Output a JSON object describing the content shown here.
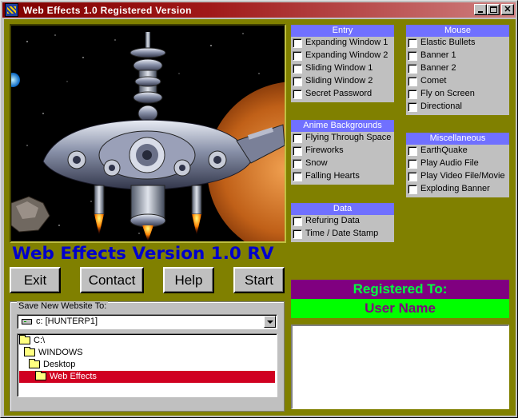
{
  "window": {
    "title": "Web Effects 1.0 Registered Version"
  },
  "app_heading": "Web Effects Version 1.0 RV",
  "buttons": {
    "exit": "Exit",
    "contact": "Contact",
    "help": "Help",
    "start": "Start"
  },
  "save": {
    "legend": "Save New Website To:",
    "drive": "c: [HUNTERP1]",
    "folders": [
      {
        "label": "C:\\",
        "selected": false
      },
      {
        "label": "WINDOWS",
        "selected": false
      },
      {
        "label": "Desktop",
        "selected": false
      },
      {
        "label": "Web Effects",
        "selected": true
      }
    ]
  },
  "panels": {
    "entry": {
      "title": "Entry",
      "items": [
        "Expanding Window 1",
        "Expanding Window 2",
        "Sliding Window 1",
        "Sliding Window 2",
        "Secret Password"
      ]
    },
    "mouse": {
      "title": "Mouse",
      "items": [
        "Elastic Bullets",
        "Banner 1",
        "Banner 2",
        "Comet",
        "Fly on Screen",
        "Directional"
      ]
    },
    "anime": {
      "title": "Anime Backgrounds",
      "items": [
        "Flying Through Space",
        "Fireworks",
        "Snow",
        "Falling Hearts"
      ]
    },
    "misc": {
      "title": "Miscellaneous",
      "items": [
        "EarthQuake",
        "Play Audio File",
        "Play Video File/Movie",
        "Exploding Banner"
      ]
    },
    "data": {
      "title": "Data",
      "items": [
        "Refuring Data",
        "Time / Date Stamp"
      ]
    }
  },
  "registration": {
    "title": "Registered To:",
    "user": "User Name"
  },
  "colors": {
    "client_bg": "#808000",
    "panel_header": "#7070ff",
    "heading": "#0000cc",
    "reg_title_bg": "#800080",
    "reg_user_bg": "#00ff00",
    "selected_folder": "#d00020"
  }
}
